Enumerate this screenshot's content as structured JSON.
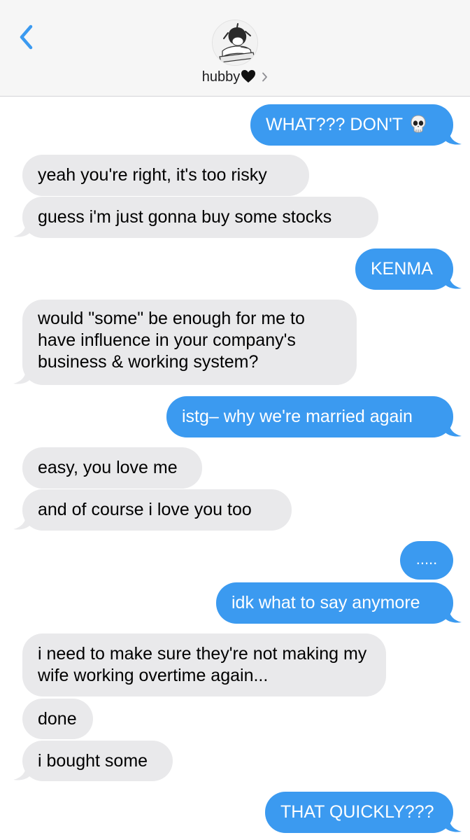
{
  "header": {
    "contact_name": "hubby",
    "heart_icon": "black-heart-emoji",
    "chevron_icon": "chevron-right-icon",
    "back_icon": "chevron-left-icon",
    "accent_color": "#3b9af0"
  },
  "messages": [
    {
      "dir": "out",
      "text": "WHAT??? DON'T",
      "emoji": "skull-emoji"
    },
    {
      "dir": "in",
      "text": "yeah you're right, it's too risky"
    },
    {
      "dir": "in",
      "text": "guess i'm just gonna buy some stocks"
    },
    {
      "dir": "out",
      "text": "KENMA"
    },
    {
      "dir": "in",
      "text": "would \"some\" be enough for me to have influence in your company's business & working system?"
    },
    {
      "dir": "out",
      "text": "istg– why we're married again"
    },
    {
      "dir": "in",
      "text": "easy, you love me"
    },
    {
      "dir": "in",
      "text": "and of course i love you too"
    },
    {
      "dir": "out",
      "text": "....."
    },
    {
      "dir": "out",
      "text": "idk what to say anymore"
    },
    {
      "dir": "in",
      "text": "i need to make sure they're not making my wife working overtime again..."
    },
    {
      "dir": "in",
      "text": "done"
    },
    {
      "dir": "in",
      "text": "i bought some"
    },
    {
      "dir": "out",
      "text": "THAT QUICKLY???"
    }
  ]
}
